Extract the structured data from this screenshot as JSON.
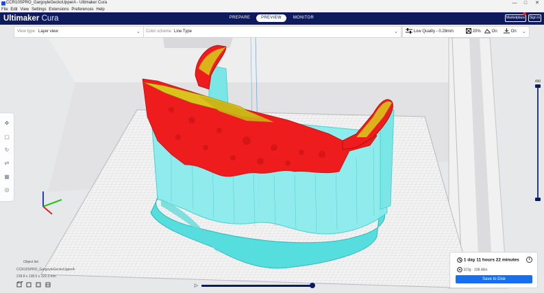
{
  "window": {
    "title": "CCR10SPRO_GargoyleGeckoUpperA - Ultimaker Cura",
    "minimize": "—",
    "maximize": "□",
    "close": "✕"
  },
  "menu": [
    "File",
    "Edit",
    "View",
    "Settings",
    "Extensions",
    "Preferences",
    "Help"
  ],
  "header": {
    "logo_bold": "Ultimaker",
    "logo_light": " Cura",
    "tabs": [
      "PREPARE",
      "PREVIEW",
      "MONITOR"
    ],
    "active_tab": "PREVIEW",
    "marketplace": "Marketplace",
    "signin": "Sign in"
  },
  "view_settings": {
    "view_type_label": "View type",
    "view_type_value": "Layer view",
    "color_scheme_label": "Color scheme",
    "color_scheme_value": "Line Type"
  },
  "print_settings": {
    "profile": "Low Quality - 0.28mm",
    "infill": "20%",
    "support": "On",
    "adhesion": "On"
  },
  "layer_slider": {
    "current_layer": "490"
  },
  "object_list": {
    "header": "Object list",
    "object_name": "CCR10SPRO_GargoyleGeckoUpperA",
    "dimensions": "218.8 x 138.5 x 122.3 mm"
  },
  "print_estimate": {
    "time": "1 day 11 hours 22 minutes",
    "material": "323g · 108.46m",
    "save_button": "Save to Disk",
    "info": "i"
  },
  "colors": {
    "header_bg": "#0d1a5e",
    "accent_blue": "#196ef0",
    "model_red": "#ee1c1c",
    "model_yellow": "#d8c21a",
    "support_cyan": "#5ee3e1"
  }
}
